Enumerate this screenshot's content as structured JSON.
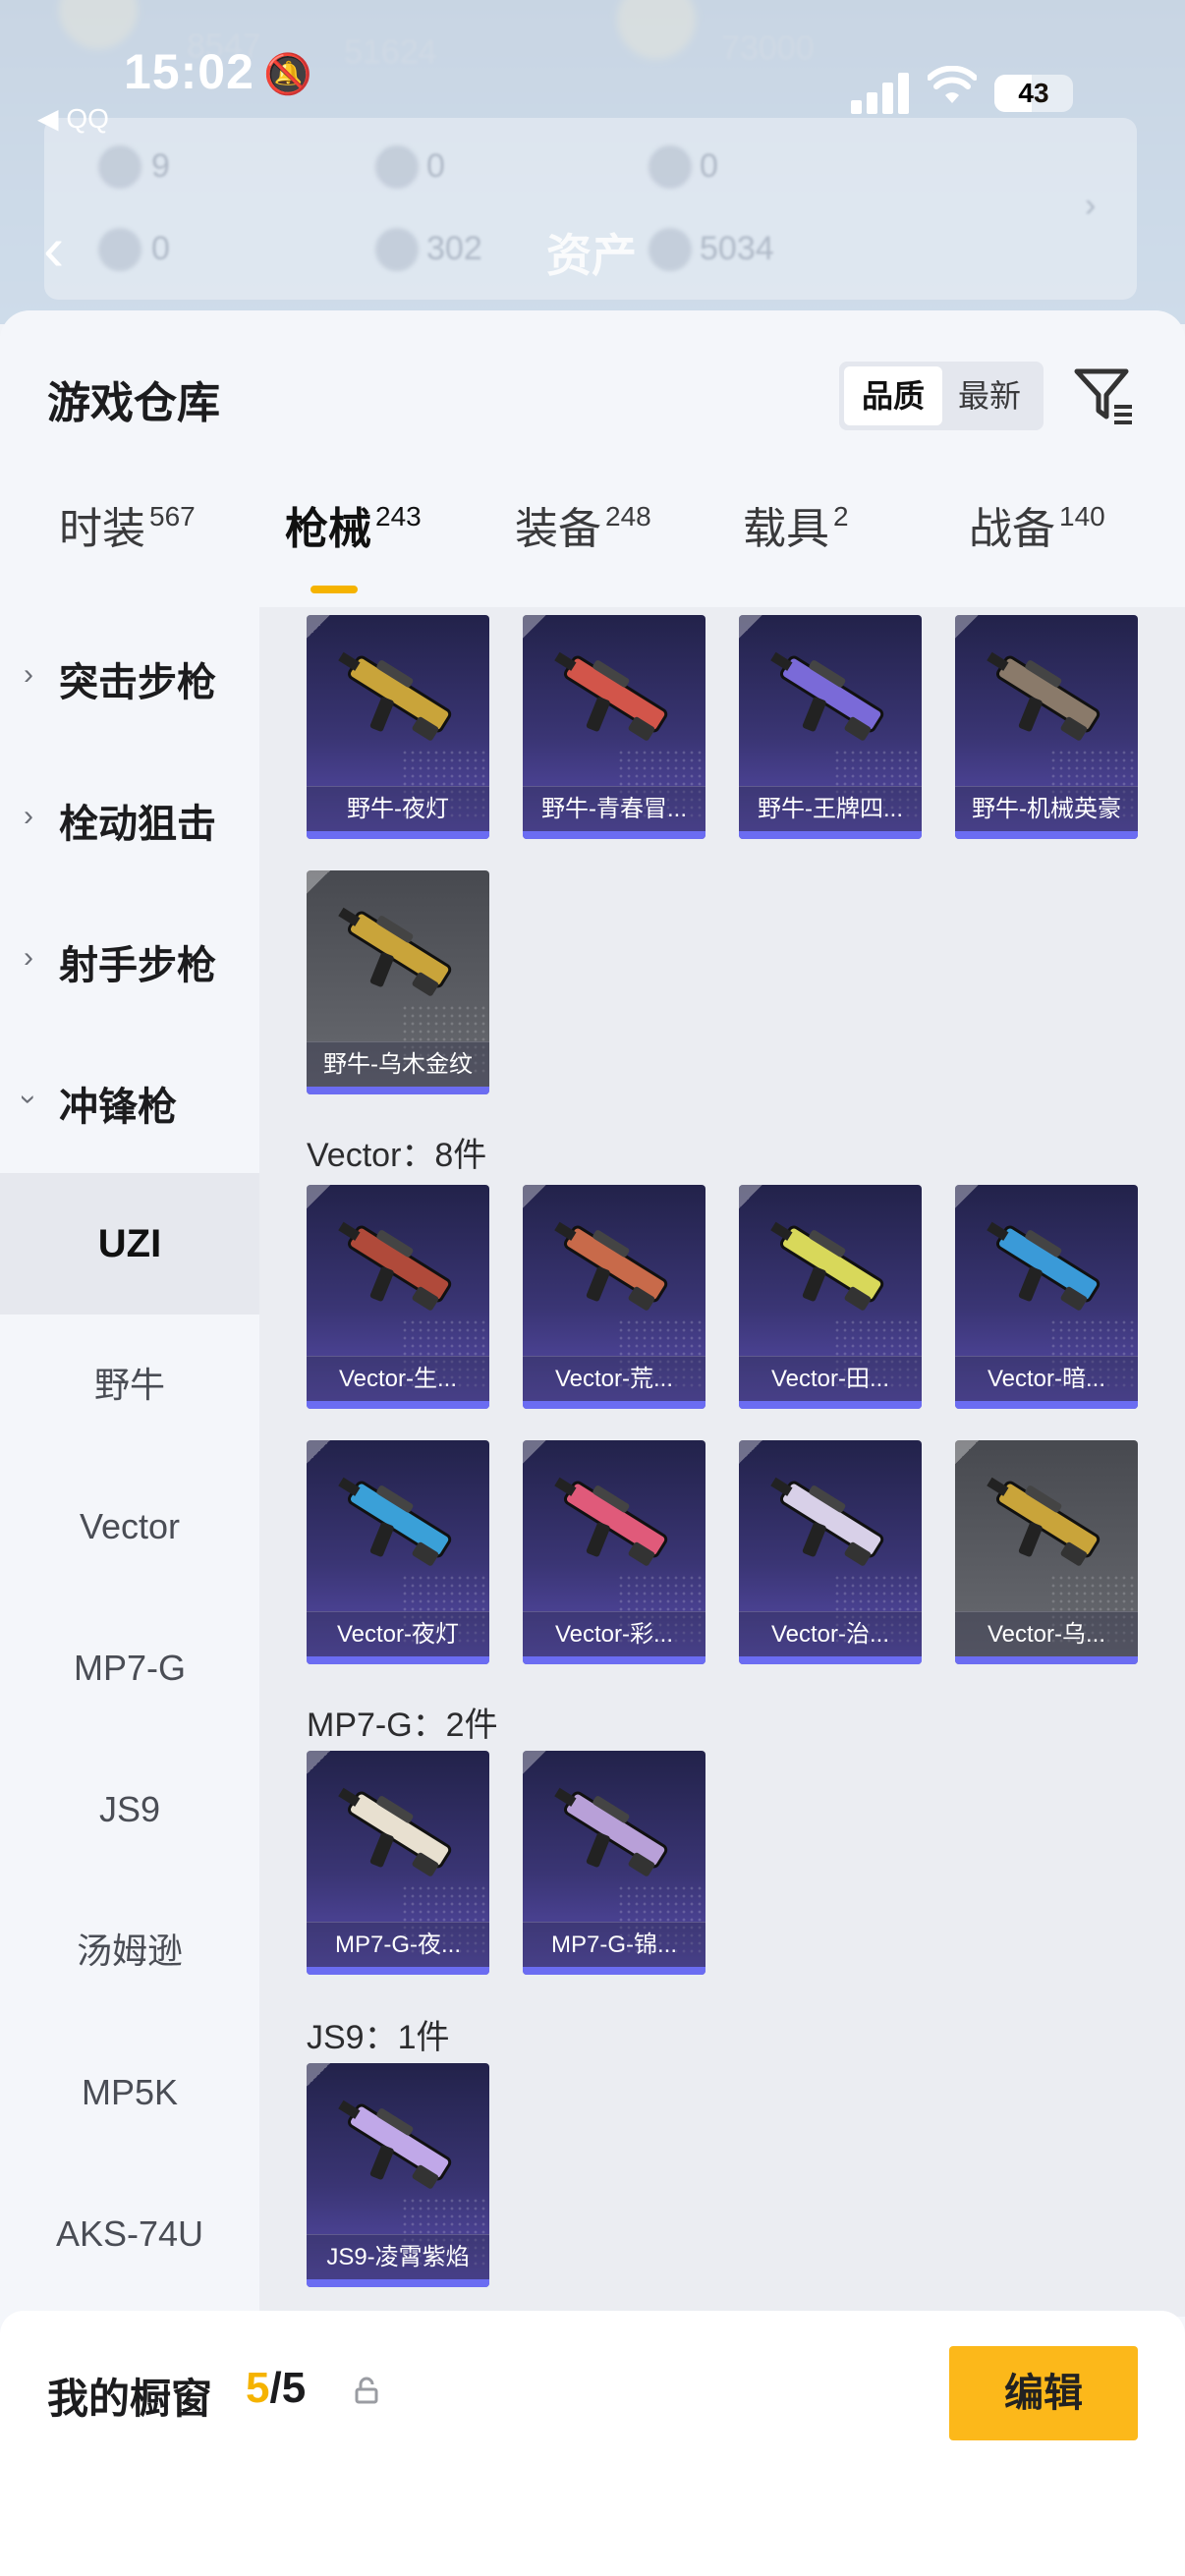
{
  "status_bar": {
    "time": "15:02",
    "back_app": "◀ QQ",
    "battery": "43"
  },
  "background": {
    "title": "资产",
    "ghost_numbers": [
      "8547",
      "51624",
      "73000",
      "9",
      "0",
      "0",
      "0",
      "302",
      "5034"
    ]
  },
  "sheet": {
    "title": "游戏仓库",
    "sort": {
      "quality": "品质",
      "latest": "最新",
      "selected": "quality"
    }
  },
  "tabs": [
    {
      "label": "时装",
      "count": "567"
    },
    {
      "label": "枪械",
      "count": "243",
      "active": true
    },
    {
      "label": "装备",
      "count": "248"
    },
    {
      "label": "载具",
      "count": "2"
    },
    {
      "label": "战备",
      "count": "140"
    }
  ],
  "categories": [
    {
      "label": "突击步枪",
      "expanded": false
    },
    {
      "label": "栓动狙击",
      "expanded": false
    },
    {
      "label": "射手步枪",
      "expanded": false
    },
    {
      "label": "冲锋枪",
      "expanded": true
    }
  ],
  "subcategories": [
    {
      "label": "UZI",
      "selected": true
    },
    {
      "label": "野牛"
    },
    {
      "label": "Vector"
    },
    {
      "label": "MP7-G"
    },
    {
      "label": "JS9"
    },
    {
      "label": "汤姆逊"
    },
    {
      "label": "MP5K"
    },
    {
      "label": "AKS-74U"
    }
  ],
  "groups": {
    "bison_items": [
      {
        "name": "野牛-夜灯",
        "tier": "purple"
      },
      {
        "name": "野牛-青春冒...",
        "tier": "purple"
      },
      {
        "name": "野牛-王牌四...",
        "tier": "purple"
      },
      {
        "name": "野牛-机械英豪",
        "tier": "purple"
      },
      {
        "name": "野牛-乌木金纹",
        "tier": "grey"
      }
    ],
    "vector": {
      "title": "Vector：8件",
      "items": [
        {
          "name": "Vector-生...",
          "tier": "purple"
        },
        {
          "name": "Vector-荒...",
          "tier": "purple"
        },
        {
          "name": "Vector-田...",
          "tier": "purple"
        },
        {
          "name": "Vector-暗...",
          "tier": "purple"
        },
        {
          "name": "Vector-夜灯",
          "tier": "purple"
        },
        {
          "name": "Vector-彩...",
          "tier": "purple"
        },
        {
          "name": "Vector-治...",
          "tier": "purple"
        },
        {
          "name": "Vector-乌...",
          "tier": "grey"
        }
      ]
    },
    "mp7": {
      "title": "MP7-G：2件",
      "items": [
        {
          "name": "MP7-G-夜...",
          "tier": "purple"
        },
        {
          "name": "MP7-G-锦...",
          "tier": "purple"
        }
      ]
    },
    "js9": {
      "title": "JS9：1件",
      "items": [
        {
          "name": "JS9-凌霄紫焰",
          "tier": "purple"
        }
      ]
    }
  },
  "bottom": {
    "label": "我的橱窗",
    "count_current": "5",
    "count_sep": "/5",
    "edit": "编辑"
  },
  "colors": {
    "accent": "#fcb81a",
    "purple_tier": "#6b6cf2",
    "card_bg": "#3a3574",
    "grey_tier": "#5c5e64"
  },
  "icons": [
    "bell-mute-icon",
    "signal-icon",
    "wifi-icon",
    "battery-icon",
    "back-chevron-icon",
    "filter-icon",
    "chevron-right-icon",
    "chevron-down-icon",
    "share-icon",
    "lock-icon"
  ]
}
